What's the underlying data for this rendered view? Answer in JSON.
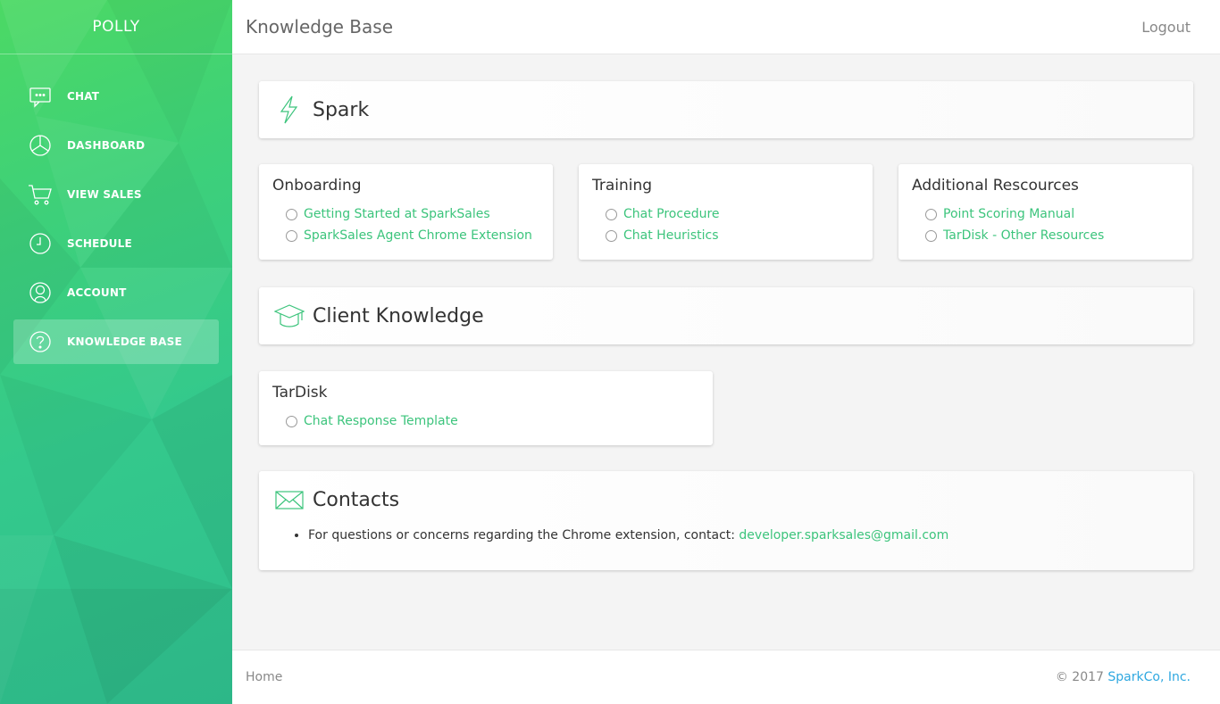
{
  "sidebar": {
    "brand": "POLLY",
    "items": [
      {
        "label": "CHAT",
        "icon": "chat-bubble-icon"
      },
      {
        "label": "DASHBOARD",
        "icon": "pie-chart-icon"
      },
      {
        "label": "VIEW SALES",
        "icon": "shopping-cart-icon"
      },
      {
        "label": "SCHEDULE",
        "icon": "clock-icon"
      },
      {
        "label": "ACCOUNT",
        "icon": "user-icon"
      },
      {
        "label": "KNOWLEDGE BASE",
        "icon": "help-circle-icon",
        "active": true
      }
    ]
  },
  "header": {
    "title": "Knowledge Base",
    "logout_label": "Logout"
  },
  "sections": {
    "spark": {
      "title": "Spark",
      "icon": "lightning-bolt-icon",
      "cards": [
        {
          "title": "Onboarding",
          "links": [
            "Getting Started at SparkSales",
            "SparkSales Agent Chrome Extension"
          ]
        },
        {
          "title": "Training",
          "links": [
            "Chat Procedure",
            "Chat Heuristics"
          ]
        },
        {
          "title": "Additional Rescources",
          "links": [
            "Point Scoring Manual",
            "TarDisk - Other Resources"
          ]
        }
      ]
    },
    "client": {
      "title": "Client Knowledge",
      "icon": "graduation-cap-icon",
      "cards": [
        {
          "title": "TarDisk",
          "links": [
            "Chat Response Template"
          ]
        }
      ]
    },
    "contacts": {
      "title": "Contacts",
      "icon": "envelope-icon",
      "text": "For questions or concerns regarding the Chrome extension, contact: ",
      "email": "developer.sparksales@gmail.com"
    }
  },
  "footer": {
    "home_label": "Home",
    "copyright": "© 2017 ",
    "company": "SparkCo, Inc."
  },
  "colors": {
    "accent_green": "#3cc47c",
    "sidebar_top": "#4cd964",
    "sidebar_bottom": "#2fbf8e",
    "footer_link": "#2fa8e0"
  }
}
